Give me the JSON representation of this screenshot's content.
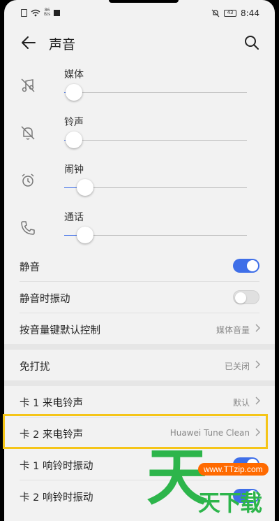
{
  "status_bar": {
    "net_top": "86",
    "net_bottom": "B/s",
    "battery": "43",
    "time": "8:44"
  },
  "appbar": {
    "title": "声音"
  },
  "volumes": [
    {
      "label": "媒体",
      "icon": "music-off-icon",
      "level": 0.03
    },
    {
      "label": "铃声",
      "icon": "bell-off-icon",
      "level": 0.03
    },
    {
      "label": "闹钟",
      "icon": "alarm-clock-icon",
      "level": 0.09
    },
    {
      "label": "通话",
      "icon": "phone-icon",
      "level": 0.09
    }
  ],
  "settings": {
    "silent": {
      "label": "静音",
      "on": true
    },
    "silent_vibrate": {
      "label": "静音时振动",
      "on": false
    },
    "volume_key": {
      "label": "按音量键默认控制",
      "value": "媒体音量"
    },
    "dnd": {
      "label": "免打扰",
      "value": "已关闭"
    },
    "sim1_ringtone": {
      "label": "卡 1 来电铃声",
      "value": "默认"
    },
    "sim2_ringtone": {
      "label": "卡 2 来电铃声",
      "value": "Huawei Tune Clean"
    },
    "sim1_vibrate": {
      "label": "卡 1 响铃时振动",
      "on": true
    },
    "sim2_vibrate": {
      "label": "卡 2 响铃时振动",
      "on": true
    }
  },
  "watermark": {
    "big": "天",
    "url": "www.TTzip.com",
    "small": "天下载"
  },
  "colors": {
    "accent": "#3f6fe8",
    "highlight": "#f5c518",
    "watermark_green": "#2db54b"
  }
}
